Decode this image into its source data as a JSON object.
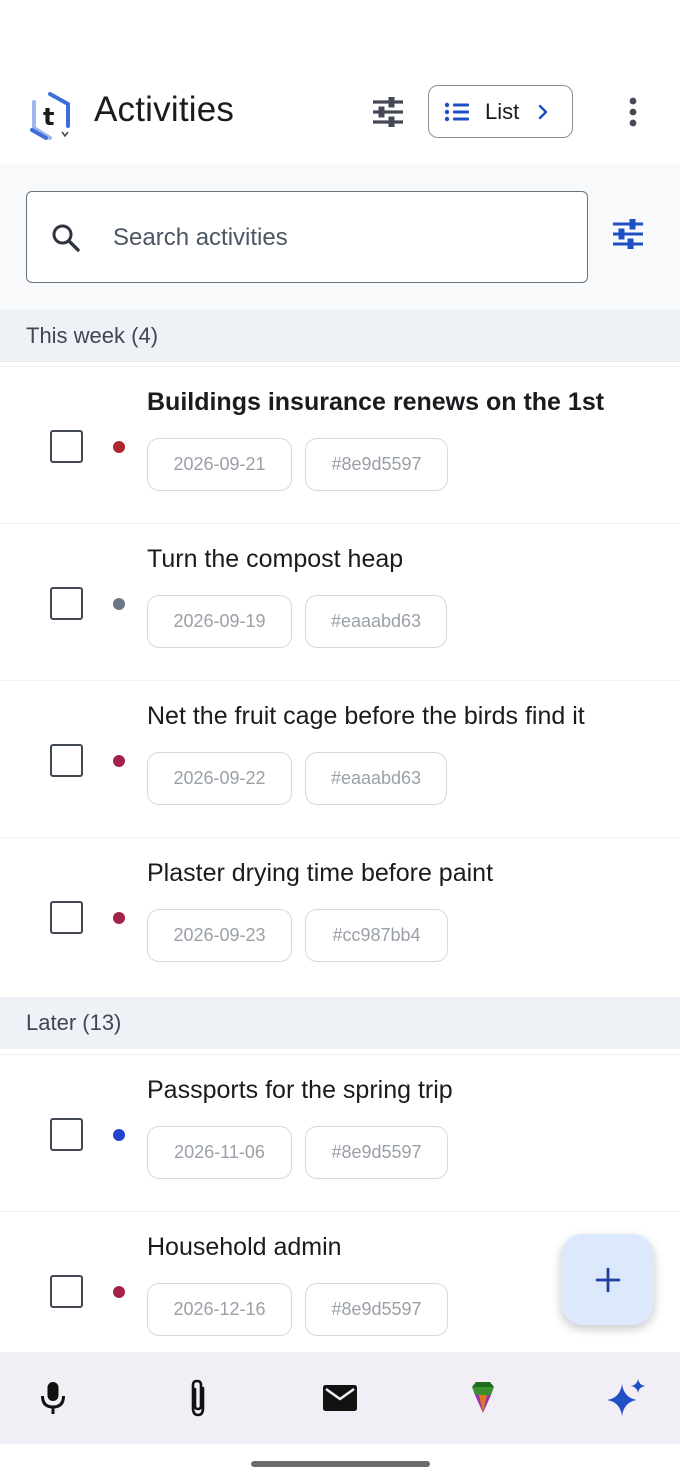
{
  "header": {
    "title": "Activities",
    "view_label": "List"
  },
  "search": {
    "placeholder": "Search activities"
  },
  "sections": [
    {
      "label": "This week (4)",
      "tasks": [
        {
          "title": "Buildings insurance renews on the 1st",
          "bold": true,
          "date": "2026-09-21",
          "tag": "#8e9d5597",
          "dot_color": "#b0262f"
        },
        {
          "title": "Turn the compost heap",
          "bold": false,
          "date": "2026-09-19",
          "tag": "#eaaabd63",
          "dot_color": "#6b7785"
        },
        {
          "title": "Net the fruit cage before the birds find it",
          "bold": false,
          "date": "2026-09-22",
          "tag": "#eaaabd63",
          "dot_color": "#a3224a"
        },
        {
          "title": "Plaster drying time before paint",
          "bold": false,
          "date": "2026-09-23",
          "tag": "#cc987bb4",
          "dot_color": "#a3224a"
        }
      ]
    },
    {
      "label": "Later (13)",
      "tasks": [
        {
          "title": "Passports for the spring trip",
          "bold": false,
          "date": "2026-11-06",
          "tag": "#8e9d5597",
          "dot_color": "#2244cc"
        },
        {
          "title": "Household admin",
          "bold": false,
          "date": "2026-12-16",
          "tag": "#8e9d5597",
          "dot_color": "#a3224a"
        }
      ]
    }
  ],
  "colors": {
    "accent": "#1e4fc4",
    "logo_blue": "#3e6fd8",
    "fab_bg": "#dce8fb",
    "bottom_bar_bg": "#f1eef6"
  },
  "bottom_bar": {
    "items": [
      "mic-icon",
      "paperclip-icon",
      "mail-icon",
      "gem-icon",
      "sparkle-icon"
    ]
  }
}
